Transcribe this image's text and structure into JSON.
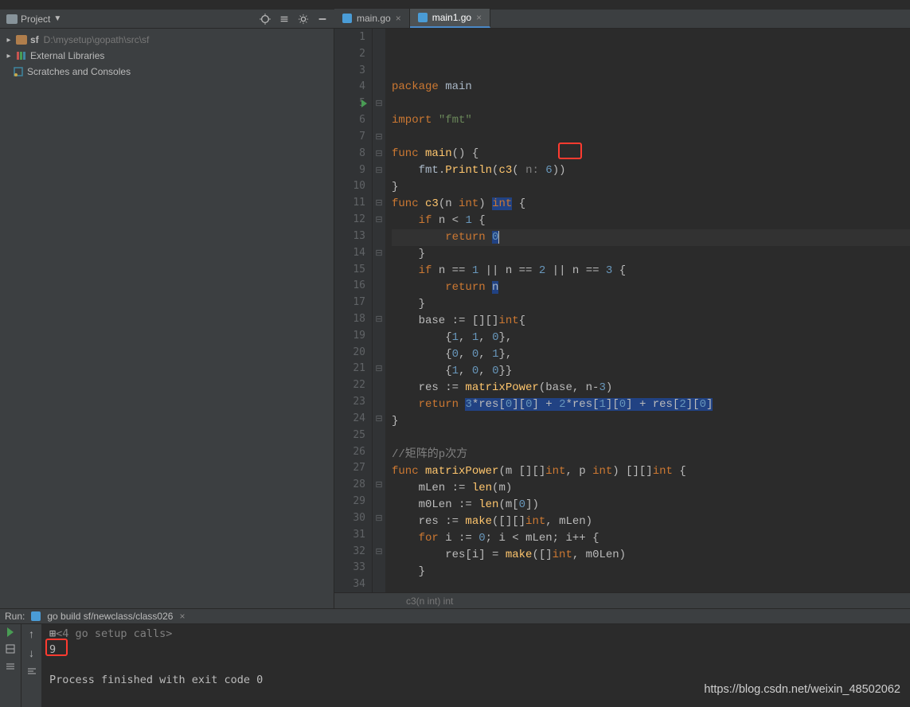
{
  "toolbar": {
    "project_label": "Project"
  },
  "tree": {
    "sf": {
      "name": "sf",
      "path": "D:\\mysetup\\gopath\\src\\sf"
    },
    "libs": "External Libraries",
    "scratch": "Scratches and Consoles"
  },
  "tabs": [
    {
      "label": "main.go",
      "active": false
    },
    {
      "label": "main1.go",
      "active": true
    }
  ],
  "code": {
    "lines": [
      {
        "n": 1,
        "marker": "",
        "html": "<span class='kw'>package</span> <span class='id'>main</span>"
      },
      {
        "n": 2,
        "marker": "",
        "html": ""
      },
      {
        "n": 3,
        "marker": "",
        "html": "<span class='kw'>import</span> <span class='str'>\"fmt\"</span>"
      },
      {
        "n": 4,
        "marker": "",
        "html": ""
      },
      {
        "n": 5,
        "marker": "▶",
        "fold": "⊟",
        "html": "<span class='kw'>func</span> <span class='fn'>main</span>() {"
      },
      {
        "n": 6,
        "marker": "",
        "html": "    <span class='id'>fmt</span>.<span class='fn'>Println</span>(<span class='fn'>c3</span>( <span class='cm'>n:</span> <span class='num'>6</span>))"
      },
      {
        "n": 7,
        "marker": "",
        "fold": "⊟",
        "html": "}"
      },
      {
        "n": 8,
        "marker": "",
        "fold": "⊟",
        "html": "<span class='kw'>func</span> <span class='fn'>c3</span>(n <span class='tp'>int</span>) <span class='hl-ret tp'>int</span> {"
      },
      {
        "n": 9,
        "marker": "",
        "fold": "⊟",
        "html": "    <span class='kw'>if</span> n &lt; <span class='num'>1</span> {"
      },
      {
        "n": 10,
        "marker": "",
        "html": "        <span class='kw'>return</span> <span class='hl-ret num'>0</span><span class='cursor'></span>",
        "caret": true
      },
      {
        "n": 11,
        "marker": "",
        "fold": "⊟",
        "html": "    }"
      },
      {
        "n": 12,
        "marker": "",
        "fold": "⊟",
        "html": "    <span class='kw'>if</span> n == <span class='num'>1</span> || n == <span class='num'>2</span> || n == <span class='num'>3</span> {"
      },
      {
        "n": 13,
        "marker": "",
        "html": "        <span class='kw'>return</span> <span class='hl-ret id'>n</span>"
      },
      {
        "n": 14,
        "marker": "",
        "fold": "⊟",
        "html": "    }"
      },
      {
        "n": 15,
        "marker": "",
        "html": "    base := [][]<span class='tp'>int</span>{"
      },
      {
        "n": 16,
        "marker": "",
        "html": "        {<span class='num'>1</span>, <span class='num'>1</span>, <span class='num'>0</span>},"
      },
      {
        "n": 17,
        "marker": "",
        "html": "        {<span class='num'>0</span>, <span class='num'>0</span>, <span class='num'>1</span>},"
      },
      {
        "n": 18,
        "marker": "",
        "fold": "⊟",
        "html": "        {<span class='num'>1</span>, <span class='num'>0</span>, <span class='num'>0</span>}}"
      },
      {
        "n": 19,
        "marker": "",
        "html": "    res := <span class='fn'>matrixPower</span>(base, n-<span class='num'>3</span>)"
      },
      {
        "n": 20,
        "marker": "",
        "html": "    <span class='kw'>return</span> <span class='hl-ret'><span class='num'>3</span>*res[<span class='num'>0</span>][<span class='num'>0</span>] + <span class='num'>2</span>*res[<span class='num'>1</span>][<span class='num'>0</span>] + res[<span class='num'>2</span>][<span class='num'>0</span>]</span>"
      },
      {
        "n": 21,
        "marker": "",
        "fold": "⊟",
        "html": "}"
      },
      {
        "n": 22,
        "marker": "",
        "html": ""
      },
      {
        "n": 23,
        "marker": "",
        "html": "<span class='cm'>//矩阵的p次方</span>"
      },
      {
        "n": 24,
        "marker": "",
        "fold": "⊟",
        "html": "<span class='kw'>func</span> <span class='fn'>matrixPower</span>(m [][]<span class='tp'>int</span>, p <span class='tp'>int</span>) [][]<span class='tp'>int</span> {"
      },
      {
        "n": 25,
        "marker": "",
        "html": "    mLen := <span class='fn'>len</span>(m)"
      },
      {
        "n": 26,
        "marker": "",
        "html": "    m0Len := <span class='fn'>len</span>(m[<span class='num'>0</span>])"
      },
      {
        "n": 27,
        "marker": "",
        "html": "    res := <span class='fn'>make</span>([][]<span class='tp'>int</span>, mLen)"
      },
      {
        "n": 28,
        "marker": "",
        "fold": "⊟",
        "html": "    <span class='kw'>for</span> i := <span class='num'>0</span>; i &lt; mLen; i++ {"
      },
      {
        "n": 29,
        "marker": "",
        "html": "        res[i] = <span class='fn'>make</span>([]<span class='tp'>int</span>, m0Len)"
      },
      {
        "n": 30,
        "marker": "",
        "fold": "⊟",
        "html": "    }"
      },
      {
        "n": 31,
        "marker": "",
        "html": ""
      },
      {
        "n": 32,
        "marker": "",
        "fold": "⊟",
        "html": "    <span class='kw'>for</span> i := <span class='num'>0</span>; i &lt; mLen; i++ {"
      },
      {
        "n": 33,
        "marker": "",
        "html": "        res[i][i] = <span class='num'>1</span>"
      },
      {
        "n": 34,
        "marker": "",
        "html": "    }"
      }
    ]
  },
  "breadcrumb": "c3(n int) int",
  "run": {
    "label": "Run:",
    "config": "go build sf/newclass/class026",
    "setup": "<4 go setup calls>",
    "output": "9",
    "exit": "Process finished with exit code 0"
  },
  "watermark": "https://blog.csdn.net/weixin_48502062"
}
